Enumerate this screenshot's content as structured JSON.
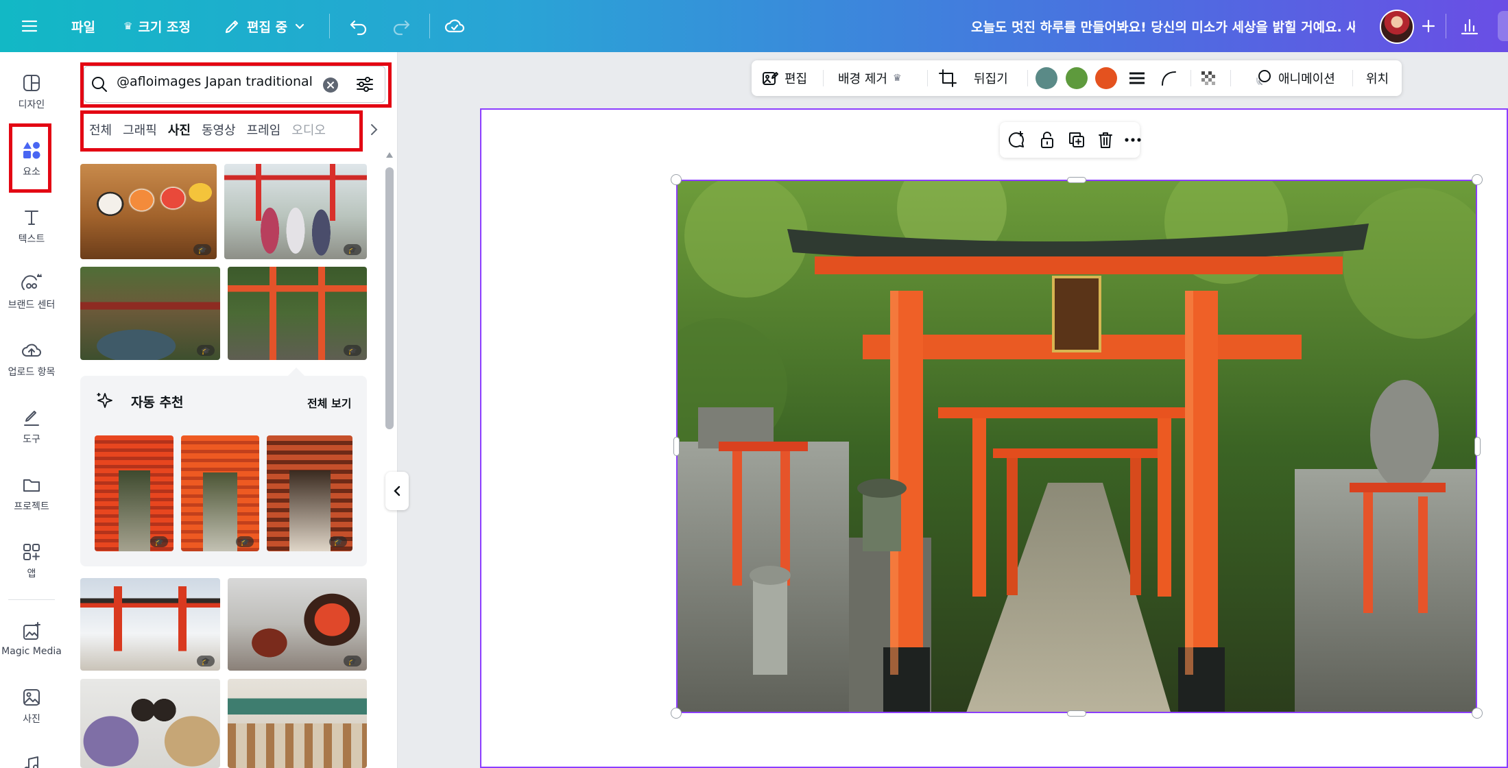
{
  "topbar": {
    "file": "파일",
    "resize": "크기 조정",
    "editing": "편집 중",
    "title": "오늘도 멋진 하루를 만들어봐요! 당신의 미소가 세상을 밝힐 거예요. 새..."
  },
  "rail": {
    "items": [
      {
        "label": "디자인",
        "icon": "design-icon"
      },
      {
        "label": "요소",
        "icon": "elements-icon"
      },
      {
        "label": "텍스트",
        "icon": "text-icon"
      },
      {
        "label": "브랜드 센터",
        "icon": "brand-icon"
      },
      {
        "label": "업로드 항목",
        "icon": "upload-icon"
      },
      {
        "label": "도구",
        "icon": "tools-icon"
      },
      {
        "label": "프로젝트",
        "icon": "folder-icon"
      },
      {
        "label": "앱",
        "icon": "apps-icon"
      },
      {
        "label": "Magic Media",
        "icon": "magic-media-icon"
      },
      {
        "label": "사진",
        "icon": "photo-icon"
      }
    ]
  },
  "panel": {
    "search_value": "@afloimages Japan traditional",
    "tabs": [
      "전체",
      "그래픽",
      "사진",
      "동영상",
      "프레임",
      "오디오"
    ],
    "active_tab": "사진",
    "suggest_title": "자동 추천",
    "suggest_all": "전체 보기"
  },
  "context_toolbar": {
    "edit": "편집",
    "bg_remove": "배경 제거",
    "flip": "뒤집기",
    "animate": "애니메이션",
    "position": "위치",
    "swatches": [
      "#5a8a87",
      "#5e9a3d",
      "#e4521f"
    ]
  },
  "colors": {
    "accent": "#8b3dff",
    "highlight": "#e30613"
  }
}
